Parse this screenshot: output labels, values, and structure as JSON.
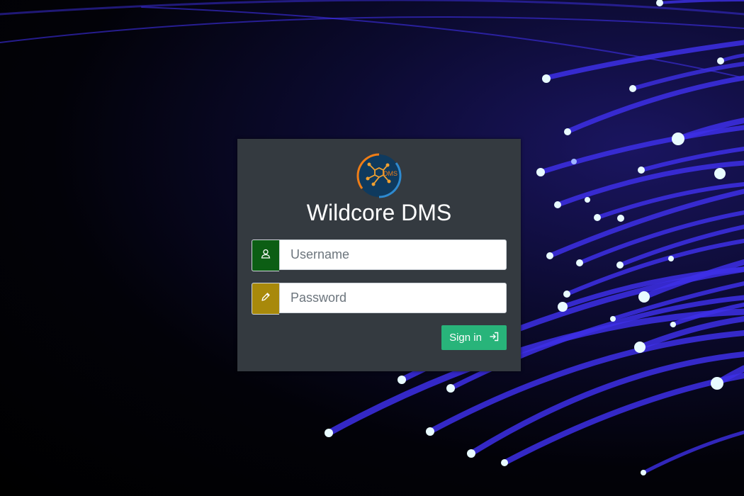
{
  "app": {
    "title": "Wildcore DMS",
    "logo_text": "DMS"
  },
  "form": {
    "username": {
      "placeholder": "Username",
      "value": "",
      "icon": "user-icon",
      "icon_color": "#0c5e14"
    },
    "password": {
      "placeholder": "Password",
      "value": "",
      "icon": "pencil-icon",
      "icon_color": "#a8890b"
    },
    "submit": {
      "label": "Sign in",
      "icon": "sign-in-icon",
      "color": "#28b47a"
    }
  },
  "theme": {
    "card_background": "#343a40",
    "background": "fiber-optic-blue"
  }
}
